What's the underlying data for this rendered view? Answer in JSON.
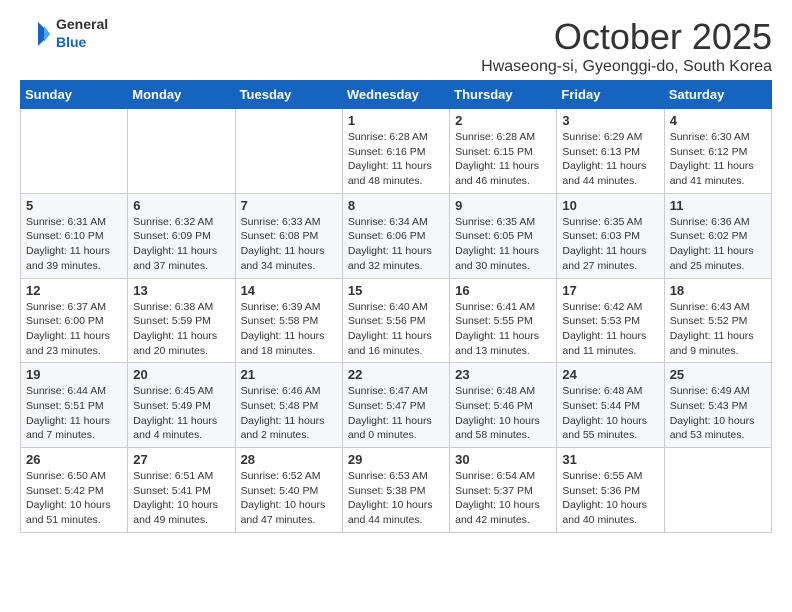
{
  "logo": {
    "text_general": "General",
    "text_blue": "Blue"
  },
  "header": {
    "month_year": "October 2025",
    "location": "Hwaseong-si, Gyeonggi-do, South Korea"
  },
  "weekdays": [
    "Sunday",
    "Monday",
    "Tuesday",
    "Wednesday",
    "Thursday",
    "Friday",
    "Saturday"
  ],
  "weeks": [
    [
      {
        "day": "",
        "info": ""
      },
      {
        "day": "",
        "info": ""
      },
      {
        "day": "",
        "info": ""
      },
      {
        "day": "1",
        "info": "Sunrise: 6:28 AM\nSunset: 6:16 PM\nDaylight: 11 hours\nand 48 minutes."
      },
      {
        "day": "2",
        "info": "Sunrise: 6:28 AM\nSunset: 6:15 PM\nDaylight: 11 hours\nand 46 minutes."
      },
      {
        "day": "3",
        "info": "Sunrise: 6:29 AM\nSunset: 6:13 PM\nDaylight: 11 hours\nand 44 minutes."
      },
      {
        "day": "4",
        "info": "Sunrise: 6:30 AM\nSunset: 6:12 PM\nDaylight: 11 hours\nand 41 minutes."
      }
    ],
    [
      {
        "day": "5",
        "info": "Sunrise: 6:31 AM\nSunset: 6:10 PM\nDaylight: 11 hours\nand 39 minutes."
      },
      {
        "day": "6",
        "info": "Sunrise: 6:32 AM\nSunset: 6:09 PM\nDaylight: 11 hours\nand 37 minutes."
      },
      {
        "day": "7",
        "info": "Sunrise: 6:33 AM\nSunset: 6:08 PM\nDaylight: 11 hours\nand 34 minutes."
      },
      {
        "day": "8",
        "info": "Sunrise: 6:34 AM\nSunset: 6:06 PM\nDaylight: 11 hours\nand 32 minutes."
      },
      {
        "day": "9",
        "info": "Sunrise: 6:35 AM\nSunset: 6:05 PM\nDaylight: 11 hours\nand 30 minutes."
      },
      {
        "day": "10",
        "info": "Sunrise: 6:35 AM\nSunset: 6:03 PM\nDaylight: 11 hours\nand 27 minutes."
      },
      {
        "day": "11",
        "info": "Sunrise: 6:36 AM\nSunset: 6:02 PM\nDaylight: 11 hours\nand 25 minutes."
      }
    ],
    [
      {
        "day": "12",
        "info": "Sunrise: 6:37 AM\nSunset: 6:00 PM\nDaylight: 11 hours\nand 23 minutes."
      },
      {
        "day": "13",
        "info": "Sunrise: 6:38 AM\nSunset: 5:59 PM\nDaylight: 11 hours\nand 20 minutes."
      },
      {
        "day": "14",
        "info": "Sunrise: 6:39 AM\nSunset: 5:58 PM\nDaylight: 11 hours\nand 18 minutes."
      },
      {
        "day": "15",
        "info": "Sunrise: 6:40 AM\nSunset: 5:56 PM\nDaylight: 11 hours\nand 16 minutes."
      },
      {
        "day": "16",
        "info": "Sunrise: 6:41 AM\nSunset: 5:55 PM\nDaylight: 11 hours\nand 13 minutes."
      },
      {
        "day": "17",
        "info": "Sunrise: 6:42 AM\nSunset: 5:53 PM\nDaylight: 11 hours\nand 11 minutes."
      },
      {
        "day": "18",
        "info": "Sunrise: 6:43 AM\nSunset: 5:52 PM\nDaylight: 11 hours\nand 9 minutes."
      }
    ],
    [
      {
        "day": "19",
        "info": "Sunrise: 6:44 AM\nSunset: 5:51 PM\nDaylight: 11 hours\nand 7 minutes."
      },
      {
        "day": "20",
        "info": "Sunrise: 6:45 AM\nSunset: 5:49 PM\nDaylight: 11 hours\nand 4 minutes."
      },
      {
        "day": "21",
        "info": "Sunrise: 6:46 AM\nSunset: 5:48 PM\nDaylight: 11 hours\nand 2 minutes."
      },
      {
        "day": "22",
        "info": "Sunrise: 6:47 AM\nSunset: 5:47 PM\nDaylight: 11 hours\nand 0 minutes."
      },
      {
        "day": "23",
        "info": "Sunrise: 6:48 AM\nSunset: 5:46 PM\nDaylight: 10 hours\nand 58 minutes."
      },
      {
        "day": "24",
        "info": "Sunrise: 6:48 AM\nSunset: 5:44 PM\nDaylight: 10 hours\nand 55 minutes."
      },
      {
        "day": "25",
        "info": "Sunrise: 6:49 AM\nSunset: 5:43 PM\nDaylight: 10 hours\nand 53 minutes."
      }
    ],
    [
      {
        "day": "26",
        "info": "Sunrise: 6:50 AM\nSunset: 5:42 PM\nDaylight: 10 hours\nand 51 minutes."
      },
      {
        "day": "27",
        "info": "Sunrise: 6:51 AM\nSunset: 5:41 PM\nDaylight: 10 hours\nand 49 minutes."
      },
      {
        "day": "28",
        "info": "Sunrise: 6:52 AM\nSunset: 5:40 PM\nDaylight: 10 hours\nand 47 minutes."
      },
      {
        "day": "29",
        "info": "Sunrise: 6:53 AM\nSunset: 5:38 PM\nDaylight: 10 hours\nand 44 minutes."
      },
      {
        "day": "30",
        "info": "Sunrise: 6:54 AM\nSunset: 5:37 PM\nDaylight: 10 hours\nand 42 minutes."
      },
      {
        "day": "31",
        "info": "Sunrise: 6:55 AM\nSunset: 5:36 PM\nDaylight: 10 hours\nand 40 minutes."
      },
      {
        "day": "",
        "info": ""
      }
    ]
  ]
}
